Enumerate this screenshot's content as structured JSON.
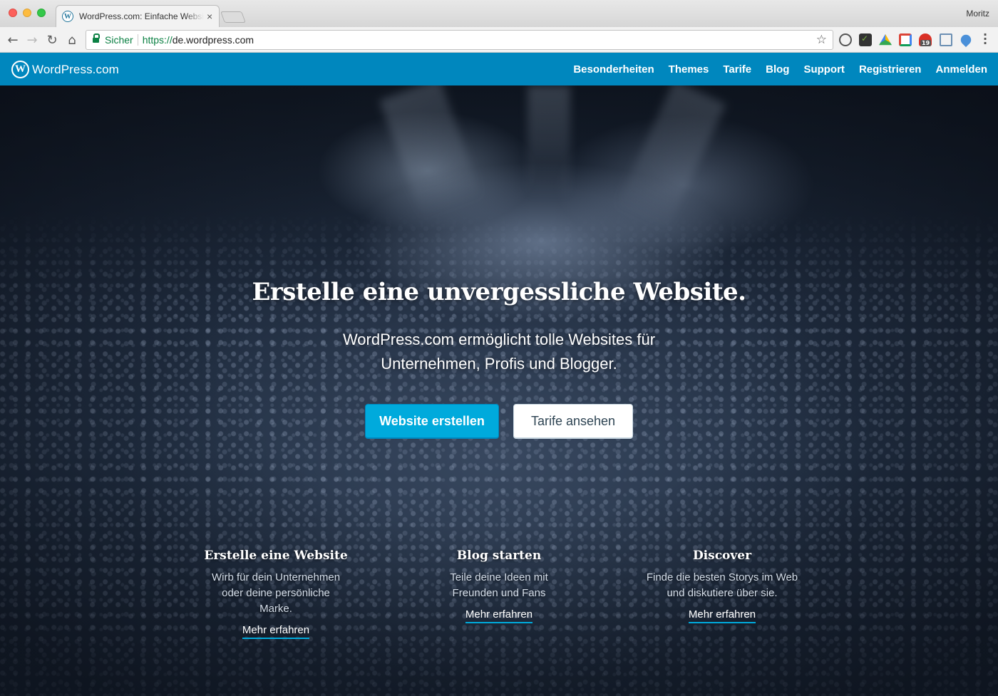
{
  "browser": {
    "tab_title": "WordPress.com: Einfache Websites",
    "tab_close": "×",
    "profile_name": "Moritz",
    "secure_label": "Sicher",
    "url_scheme": "https://",
    "url_host": "de.wordpress.com",
    "extension_badge": "19",
    "icons": {
      "back": "back-arrow-icon",
      "forward": "forward-arrow-icon",
      "reload": "reload-icon",
      "home": "home-icon",
      "lock": "lock-icon",
      "star": "star-icon",
      "menu": "kebab-menu-icon"
    }
  },
  "site": {
    "brand_name": "WordPress.com",
    "brand_color": "#0087be",
    "accent_color": "#00aadc",
    "nav": [
      "Besonderheiten",
      "Themes",
      "Tarife",
      "Blog",
      "Support",
      "Registrieren",
      "Anmelden"
    ]
  },
  "hero": {
    "title": "Erstelle eine unvergessliche Website.",
    "subtitle": "WordPress.com ermöglicht tolle Websites für Unternehmen, Profis und Blogger.",
    "primary_button": "Website erstellen",
    "secondary_button": "Tarife ansehen"
  },
  "features": [
    {
      "title": "Erstelle eine Website",
      "text": "Wirb für dein Unternehmen oder deine persönliche Marke.",
      "link": "Mehr erfahren"
    },
    {
      "title": "Blog starten",
      "text": "Teile deine Ideen mit Freunden und Fans",
      "link": "Mehr erfahren"
    },
    {
      "title": "Discover",
      "text": "Finde die besten Storys im Web und diskutiere über sie.",
      "link": "Mehr erfahren"
    }
  ]
}
